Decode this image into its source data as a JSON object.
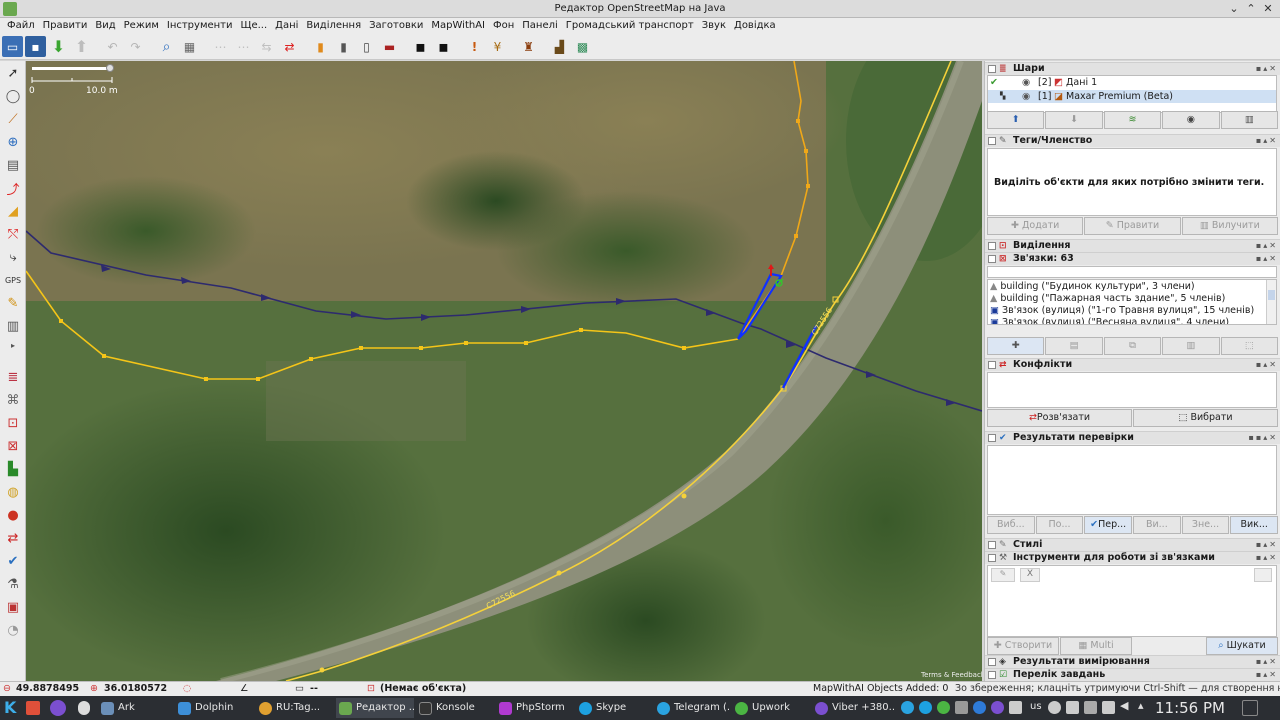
{
  "window": {
    "title": "Редактор OpenStreetMap на Java"
  },
  "menu": [
    "Файл",
    "Правити",
    "Вид",
    "Режим",
    "Інструменти",
    "Ще...",
    "Дані",
    "Виділення",
    "Заготовки",
    "MapWithAI",
    "Фон",
    "Панелі",
    "Громадський транспорт",
    "Звук",
    "Довідка"
  ],
  "map": {
    "scale_left": "0",
    "scale_right": "10.0 m",
    "road_label_1": "С72556",
    "road_label_2": "С72556",
    "attribution": "Terms & Feedback"
  },
  "layers": {
    "title": "Шари",
    "rows": [
      {
        "index": "[2]",
        "name": "Дані 1"
      },
      {
        "index": "[1]",
        "name": "Maxar Premium (Beta)"
      }
    ]
  },
  "tags": {
    "title": "Теги/Членство",
    "hint": "Виділіть об'єкти для яких потрібно змінити теги.",
    "buttons": [
      "Додати",
      "Правити",
      "Вилучити"
    ]
  },
  "selection": {
    "title": "Виділення"
  },
  "relations": {
    "title": "Зв'язки: 63",
    "items": [
      "building (\"Будинок культури\", 3 члени)",
      "building (\"Пажарная часть здание\", 5 членів)",
      "Зв'язок (вулиця) (\"1-го Травня вулиця\", 15 членів)",
      "Зв'язок (вулиця) (\"Весняна вулиця\", 4 члени)"
    ]
  },
  "conflicts": {
    "title": "Конфлікти",
    "buttons": [
      "Розв'язати",
      "Вибрати"
    ]
  },
  "validation": {
    "title": "Результати перевірки",
    "buttons": [
      "Виб...",
      "По...",
      "Пер...",
      "Ви...",
      "Зне...",
      "Вик..."
    ]
  },
  "styles": {
    "title": "Стилі"
  },
  "reltools": {
    "title": "Інструменти для роботи зі зв'язками",
    "buttons": [
      "Створити",
      "Multi",
      "Шукати"
    ],
    "small": "X"
  },
  "measurement": {
    "title": "Результати вимірювання"
  },
  "todo": {
    "title": "Перелік завдань"
  },
  "status": {
    "lat": "49.8878495",
    "lon": "36.0180572",
    "dash": "--",
    "object": "(Немає об'єкта)",
    "mapwithai": "MapWithAI Objects Added: 0",
    "hint": "Зо збереження; клацніть утримуючи Ctrl-Shift — для створення нової лінії"
  },
  "taskbar": {
    "apps": [
      "Ark",
      "Dolphin",
      "RU:Tag...",
      "Редактор ...",
      "Konsole",
      "PhpStorm",
      "Skype",
      "Telegram (...",
      "Upwork",
      "Viber +380..."
    ],
    "tray_lang": "us",
    "clock": "11:56 PM"
  },
  "colors": {
    "road_yellow": "#f5d13a",
    "relation_purple": "#2d2a6e",
    "selected_blue": "#1030ff",
    "imagery_green": "#4e6a3a"
  }
}
